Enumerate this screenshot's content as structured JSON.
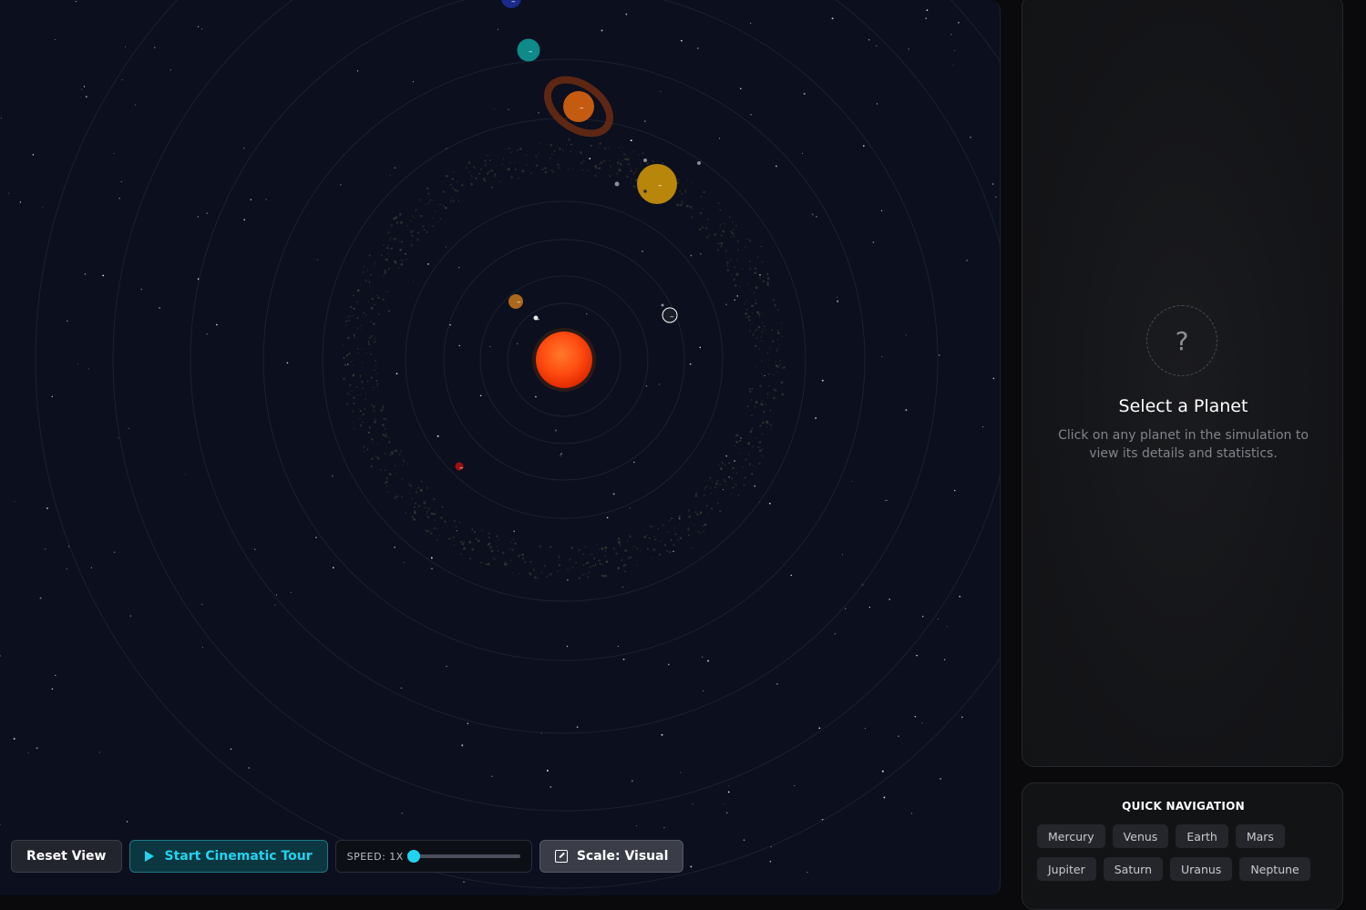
{
  "simulation": {
    "planets": [
      {
        "name": "mercury",
        "label": "–",
        "color": "#c8781c"
      },
      {
        "name": "venus",
        "label": "–",
        "color": "#e8e8e8"
      },
      {
        "name": "earth",
        "label": "–",
        "color": "#3a5a8a"
      },
      {
        "name": "mars",
        "label": "–",
        "color": "#a01010"
      },
      {
        "name": "jupiter",
        "label": "–",
        "color": "#b8860b"
      },
      {
        "name": "saturn",
        "label": "–",
        "color": "#c55a11"
      },
      {
        "name": "uranus",
        "label": "–",
        "color": "#0f8a8a"
      },
      {
        "name": "neptune",
        "label": "–",
        "color": "#1a2a8a"
      }
    ],
    "sun_color": "#ff4a10"
  },
  "controls": {
    "reset_label": "Reset View",
    "tour_label": "Start Cinematic Tour",
    "speed_label": "SPEED: 1X",
    "speed_fraction": 0.0,
    "scale_label": "Scale: Visual"
  },
  "info": {
    "placeholder_symbol": "?",
    "title": "Select a Planet",
    "description": "Click on any planet in the simulation to view its details and statistics."
  },
  "quick_nav": {
    "title": "QUICK NAVIGATION",
    "planets": [
      "Mercury",
      "Venus",
      "Earth",
      "Mars",
      "Jupiter",
      "Saturn",
      "Uranus",
      "Neptune"
    ]
  },
  "colors": {
    "accent": "#22d3ee",
    "background": "#0b0f1e"
  }
}
